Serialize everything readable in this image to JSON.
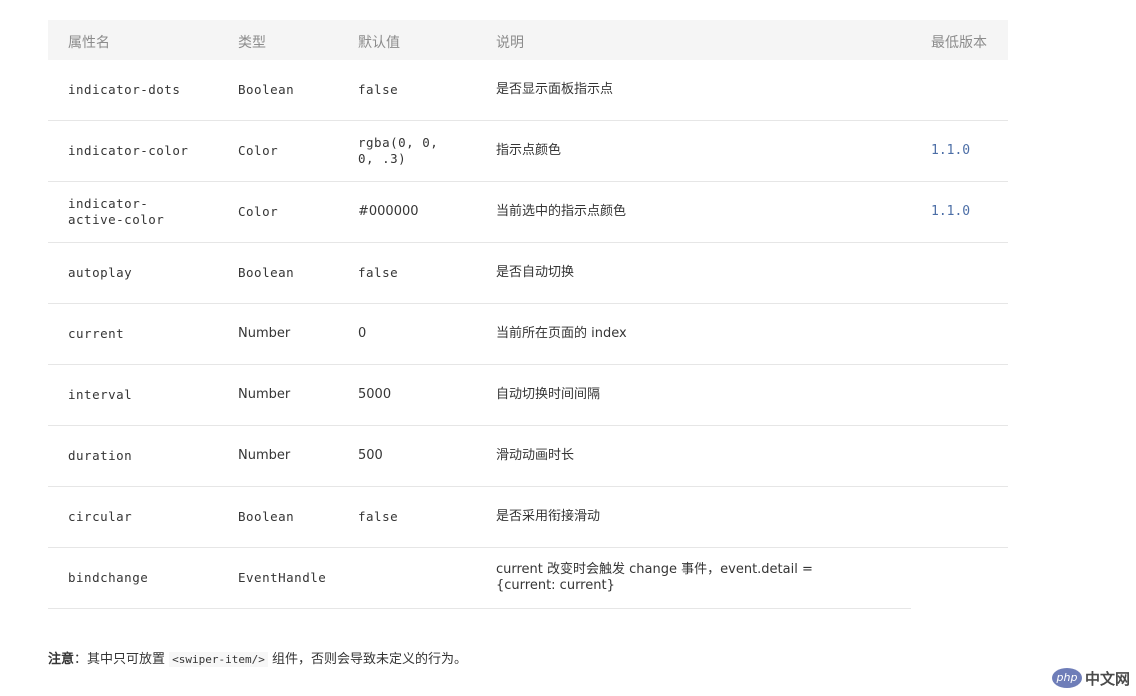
{
  "table": {
    "headers": [
      "属性名",
      "类型",
      "默认值",
      "说明",
      "最低版本"
    ],
    "rows": [
      {
        "name": "indicator-dots",
        "type": "Boolean",
        "default": "false",
        "desc": "是否显示面板指示点",
        "version": ""
      },
      {
        "name": "indicator-color",
        "type": "Color",
        "default": "rgba(0, 0, 0, .3)",
        "desc": "指示点颜色",
        "version": "1.1.0"
      },
      {
        "name": "indicator-active-color",
        "type": "Color",
        "default": "#000000",
        "desc": "当前选中的指示点颜色",
        "version": "1.1.0"
      },
      {
        "name": "autoplay",
        "type": "Boolean",
        "default": "false",
        "desc": "是否自动切换",
        "version": ""
      },
      {
        "name": "current",
        "type": "Number",
        "default": "0",
        "desc": "当前所在页面的 index",
        "version": ""
      },
      {
        "name": "interval",
        "type": "Number",
        "default": "5000",
        "desc": "自动切换时间间隔",
        "version": ""
      },
      {
        "name": "duration",
        "type": "Number",
        "default": "500",
        "desc": "滑动动画时长",
        "version": ""
      },
      {
        "name": "circular",
        "type": "Boolean",
        "default": "false",
        "desc": "是否采用衔接滑动",
        "version": ""
      },
      {
        "name": "bindchange",
        "type": "EventHandle",
        "default": "",
        "desc": "current 改变时会触发 change 事件，event.detail = {current: current}",
        "version": ""
      }
    ]
  },
  "note": {
    "label": "注意",
    "prefix": "：其中只可放置 ",
    "code": "<swiper-item/>",
    "suffix": " 组件，否则会导致未定义的行为。"
  },
  "watermark": {
    "badge": "php",
    "text": "中文网"
  }
}
